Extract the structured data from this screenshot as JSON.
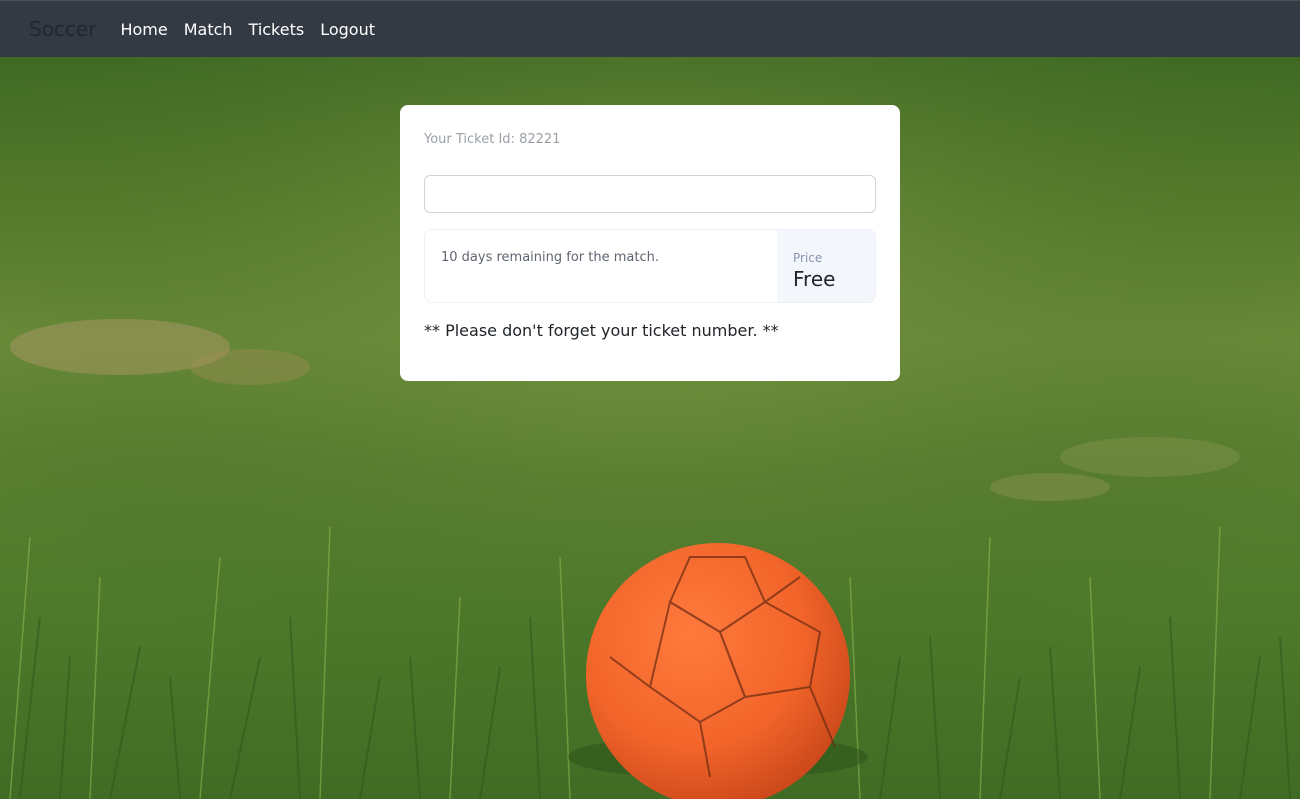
{
  "navbar": {
    "brand": "Soccer",
    "links": [
      {
        "label": "Home"
      },
      {
        "label": "Match"
      },
      {
        "label": "Tickets"
      },
      {
        "label": "Logout"
      }
    ]
  },
  "card": {
    "ticket_id_text": "Your Ticket Id: 82221",
    "ticket_input_value": "",
    "ticket_input_placeholder": "",
    "remaining_text": "10 days remaining for the match.",
    "price_label": "Price",
    "price_value": "Free",
    "reminder_text": "** Please don't forget your ticket number. **"
  },
  "colors": {
    "navbar_bg": "#343a44",
    "card_bg": "#ffffff",
    "price_panel_bg": "#f3f6fb",
    "ball": "#f2652a",
    "grass": "#557a2a"
  },
  "background_image": {
    "icon": "soccer-ball-on-grass-photo"
  }
}
